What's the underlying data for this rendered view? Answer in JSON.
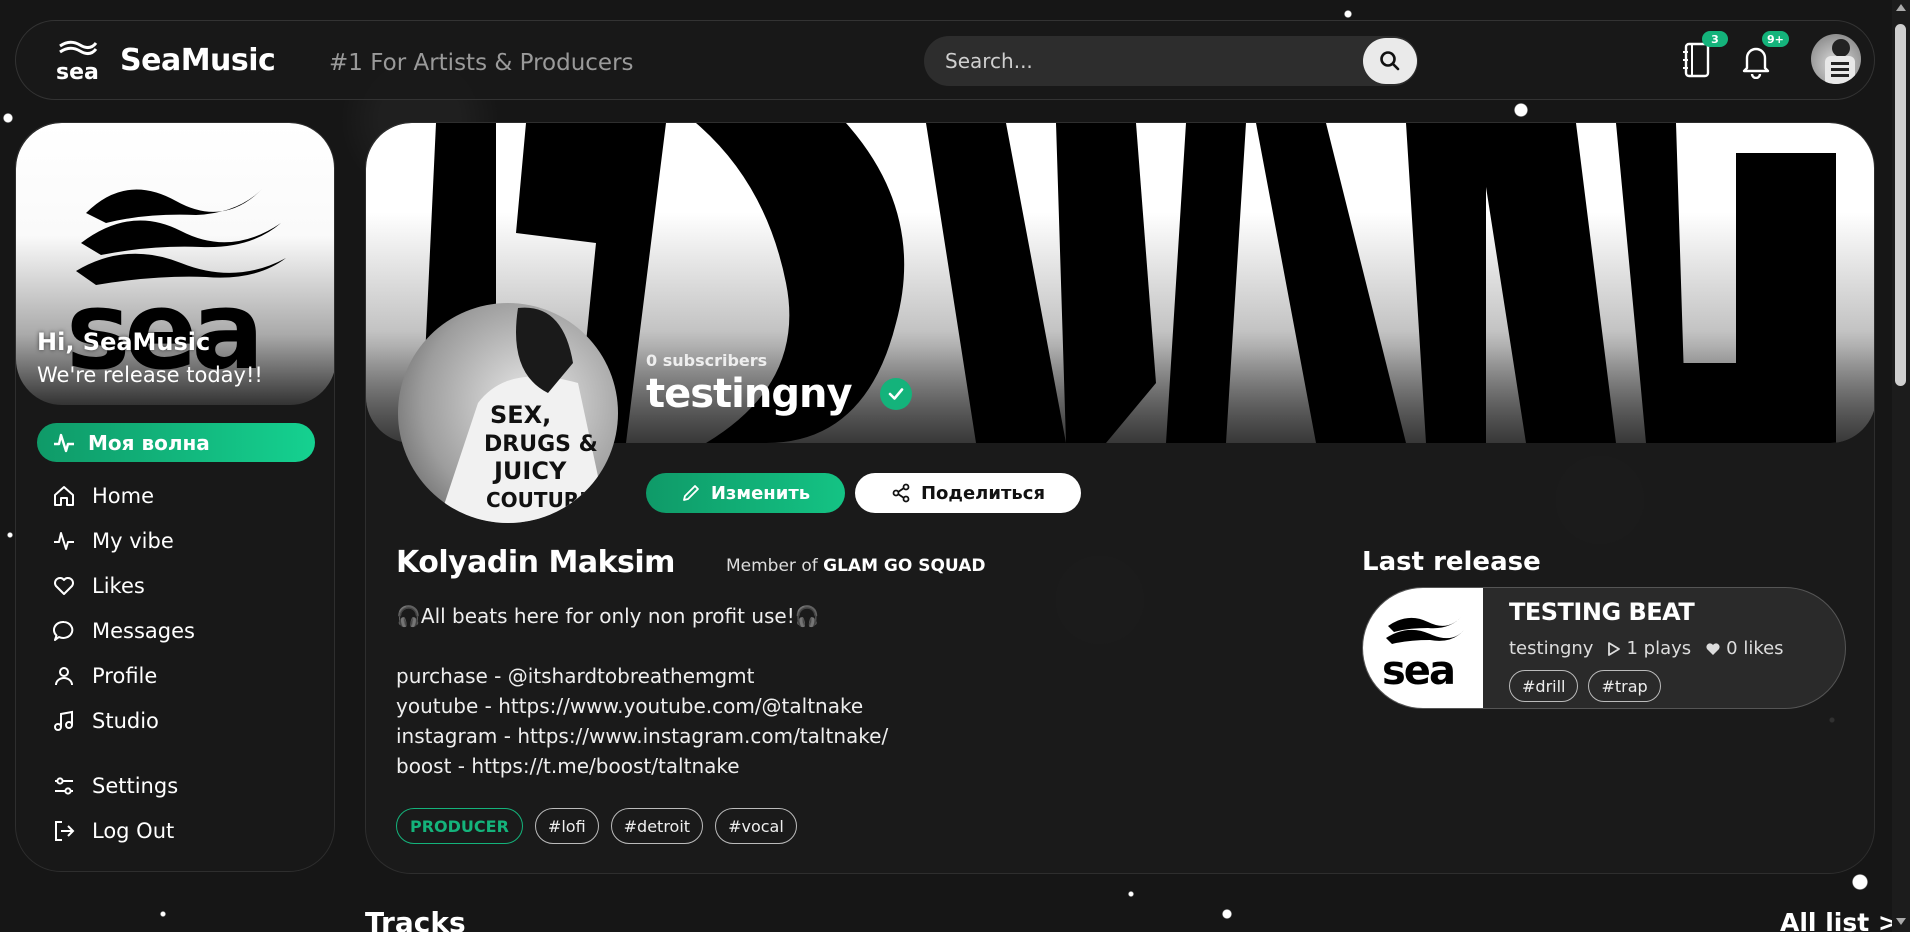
{
  "header": {
    "brand_name": "SeaMusic",
    "brand_tagline": "#1 For Artists & Producers",
    "logo_text": "sea",
    "search_placeholder": "Search...",
    "notebook_badge": "3",
    "bell_badge": "9+"
  },
  "sidebar": {
    "greeting": "Hi, SeaMusic",
    "subtitle": "We're release today!!",
    "logo_text": "sea",
    "active_item": "Моя волна",
    "items": [
      {
        "label": "Home",
        "icon": "home-icon"
      },
      {
        "label": "My vibe",
        "icon": "pulse-icon"
      },
      {
        "label": "Likes",
        "icon": "heart-icon"
      },
      {
        "label": "Messages",
        "icon": "message-icon"
      },
      {
        "label": "Profile",
        "icon": "user-icon"
      },
      {
        "label": "Studio",
        "icon": "music-note-icon"
      },
      {
        "label": "Settings",
        "icon": "sliders-icon"
      },
      {
        "label": "Log Out",
        "icon": "logout-icon"
      }
    ]
  },
  "profile": {
    "subscribers": "0 subscribers",
    "username": "testingny",
    "edit_label": "Изменить",
    "share_label": "Поделиться",
    "full_name": "Kolyadin Maksim",
    "member_prefix": "Member of",
    "member_group": "GLAM GO SQUAD",
    "bio": "🎧All beats here for only non profit use!🎧",
    "links": [
      "purchase - @itshardtobreathemgmt",
      "youtube - https://www.youtube.com/@taltnake",
      "instagram - https://www.instagram.com/taltnake/",
      "boost - https://t.me/boost/taltnake"
    ],
    "role": "PRODUCER",
    "tags": [
      "#lofi",
      "#detroit",
      "#vocal"
    ],
    "avatar_shirt_text": [
      "SEX,",
      "DRUGS &",
      "JUICY",
      "COUTURE"
    ]
  },
  "last_release": {
    "heading": "Last release",
    "title": "TESTING BEAT",
    "artist": "testingny",
    "plays": "1 plays",
    "likes": "0 likes",
    "tags": [
      "#drill",
      "#trap"
    ],
    "cover_text": "sea"
  },
  "tracks": {
    "heading": "Tracks",
    "all_list": "All list >"
  },
  "colors": {
    "accent": "#14b37b",
    "background": "#161616"
  }
}
